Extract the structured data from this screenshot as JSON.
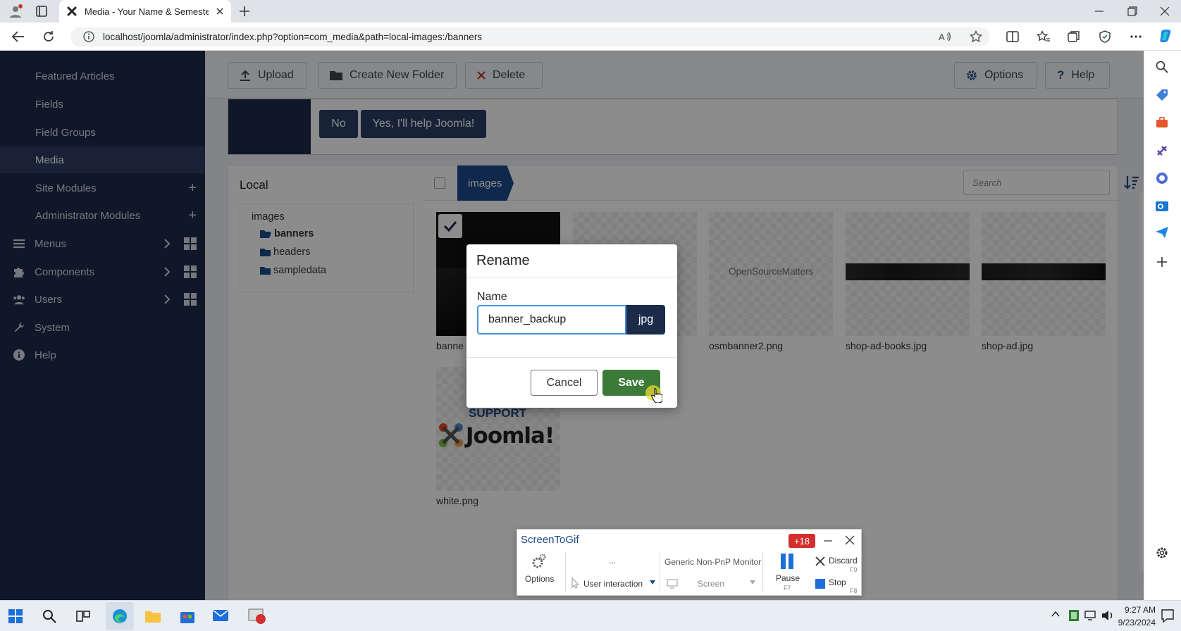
{
  "browser": {
    "tab_title": "Media - Your Name & Semester y",
    "url": "localhost/joomla/administrator/index.php?option=com_media&path=local-images:/banners"
  },
  "sidebar": {
    "items": [
      {
        "label": "Featured Articles"
      },
      {
        "label": "Fields"
      },
      {
        "label": "Field Groups"
      },
      {
        "label": "Media"
      },
      {
        "label": "Site Modules"
      },
      {
        "label": "Administrator Modules"
      },
      {
        "label": "Menus"
      },
      {
        "label": "Components"
      },
      {
        "label": "Users"
      },
      {
        "label": "System"
      },
      {
        "label": "Help"
      }
    ]
  },
  "toolbar": {
    "upload": "Upload",
    "create_folder": "Create New Folder",
    "delete": "Delete",
    "options": "Options",
    "help": "Help"
  },
  "stats": {
    "no": "No",
    "yes": "Yes, I'll help Joomla!"
  },
  "media": {
    "tree_title": "Local",
    "tree_root": "images",
    "folders": [
      "banners",
      "headers",
      "sampledata"
    ],
    "breadcrumb": "images",
    "search_placeholder": "Search",
    "files": [
      {
        "name": "banne"
      },
      {
        "name": ""
      },
      {
        "name": "osmbanner2.png",
        "thumb_text": "OpenSourceMatters"
      },
      {
        "name": "shop-ad-books.jpg"
      },
      {
        "name": "shop-ad.jpg"
      },
      {
        "name": "white.png",
        "thumb_text1": "SUPPORT",
        "thumb_text2": "Joomla!"
      }
    ]
  },
  "dialog": {
    "title": "Rename",
    "name_label": "Name",
    "name_value": "banner_backup",
    "extension": "jpg",
    "cancel": "Cancel",
    "save": "Save"
  },
  "screentogif": {
    "title": "ScreenToGif",
    "badge": "+18",
    "options": "Options",
    "dots": "...",
    "user_interaction": "User interaction",
    "monitor": "Generic Non-PnP Monitor",
    "screen": "Screen",
    "pause": "Pause",
    "pause_key": "F7",
    "discard": "Discard",
    "discard_key": "F9",
    "stop": "Stop",
    "stop_key": "F8"
  },
  "taskbar": {
    "time": "9:27 AM",
    "date": "9/23/2024"
  },
  "colors": {
    "sidebar": "#1c2b4a",
    "accent": "#1c4b8c",
    "save": "#3c7a3a"
  }
}
